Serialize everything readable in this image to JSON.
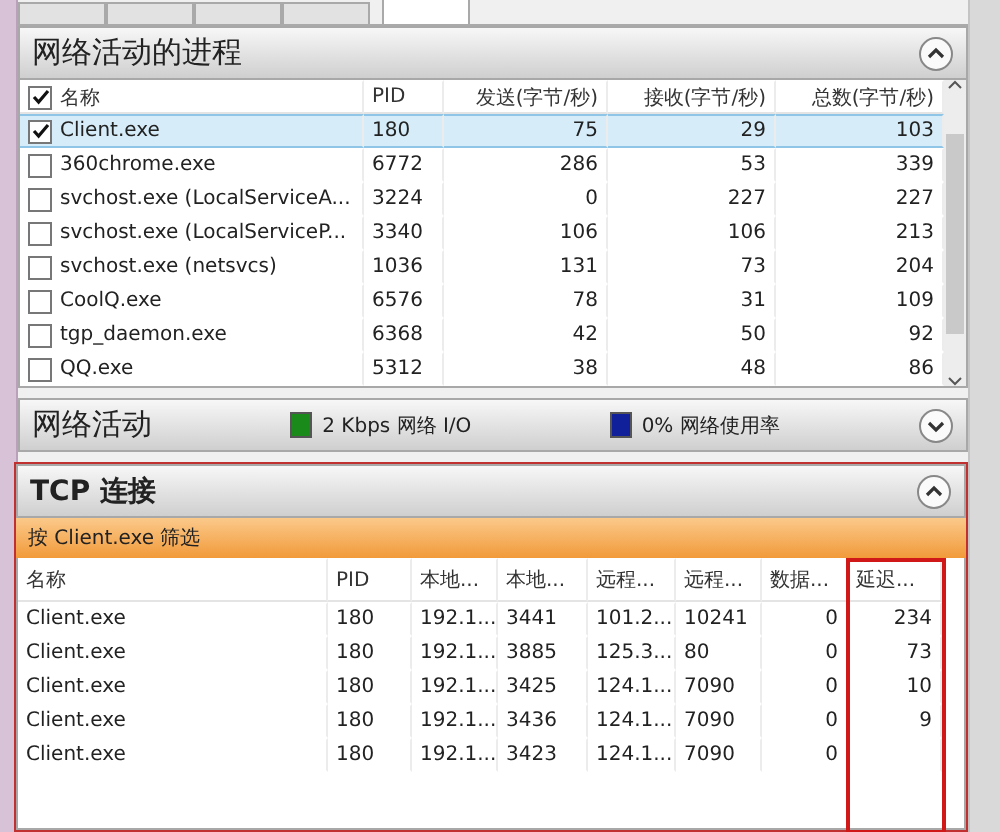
{
  "tabs": [
    {
      "selected": false
    },
    {
      "selected": false
    },
    {
      "selected": false
    },
    {
      "selected": false
    },
    {
      "selected": true
    }
  ],
  "processes": {
    "title": "网络活动的进程",
    "expanded": true,
    "header_checked": true,
    "columns": [
      "名称",
      "PID",
      "发送(字节/秒)",
      "接收(字节/秒)",
      "总数(字节/秒)"
    ],
    "rows": [
      {
        "checked": true,
        "selected": true,
        "cells": [
          "Client.exe",
          "180",
          "75",
          "29",
          "103"
        ]
      },
      {
        "checked": false,
        "selected": false,
        "cells": [
          "360chrome.exe",
          "6772",
          "286",
          "53",
          "339"
        ]
      },
      {
        "checked": false,
        "selected": false,
        "cells": [
          "svchost.exe (LocalServiceA...",
          "3224",
          "0",
          "227",
          "227"
        ]
      },
      {
        "checked": false,
        "selected": false,
        "cells": [
          "svchost.exe (LocalServiceP...",
          "3340",
          "106",
          "106",
          "213"
        ]
      },
      {
        "checked": false,
        "selected": false,
        "cells": [
          "svchost.exe (netsvcs)",
          "1036",
          "131",
          "73",
          "204"
        ]
      },
      {
        "checked": false,
        "selected": false,
        "cells": [
          "CoolQ.exe",
          "6576",
          "78",
          "31",
          "109"
        ]
      },
      {
        "checked": false,
        "selected": false,
        "cells": [
          "tgp_daemon.exe",
          "6368",
          "42",
          "50",
          "92"
        ]
      },
      {
        "checked": false,
        "selected": false,
        "cells": [
          "QQ.exe",
          "5312",
          "38",
          "48",
          "86"
        ]
      }
    ]
  },
  "activity": {
    "title": "网络活动",
    "expanded": false,
    "legend": [
      {
        "label": "2 Kbps 网络 I/O",
        "color": "#1a8a1a"
      },
      {
        "label": "0% 网络使用率",
        "color": "#10209a"
      }
    ]
  },
  "tcp": {
    "title": "TCP 连接",
    "expanded": true,
    "filter": "按 Client.exe 筛选",
    "columns": [
      "名称",
      "PID",
      "本地...",
      "本地...",
      "远程...",
      "远程...",
      "数据...",
      "延迟..."
    ],
    "rows": [
      {
        "cells": [
          "Client.exe",
          "180",
          "192.1...",
          "3441",
          "101.2...",
          "10241",
          "0",
          "234"
        ]
      },
      {
        "cells": [
          "Client.exe",
          "180",
          "192.1...",
          "3885",
          "125.3...",
          "80",
          "0",
          "73"
        ]
      },
      {
        "cells": [
          "Client.exe",
          "180",
          "192.1...",
          "3425",
          "124.1...",
          "7090",
          "0",
          "10"
        ]
      },
      {
        "cells": [
          "Client.exe",
          "180",
          "192.1...",
          "3436",
          "124.1...",
          "7090",
          "0",
          "9"
        ]
      },
      {
        "cells": [
          "Client.exe",
          "180",
          "192.1...",
          "3423",
          "124.1...",
          "7090",
          "0"
        ]
      }
    ]
  }
}
